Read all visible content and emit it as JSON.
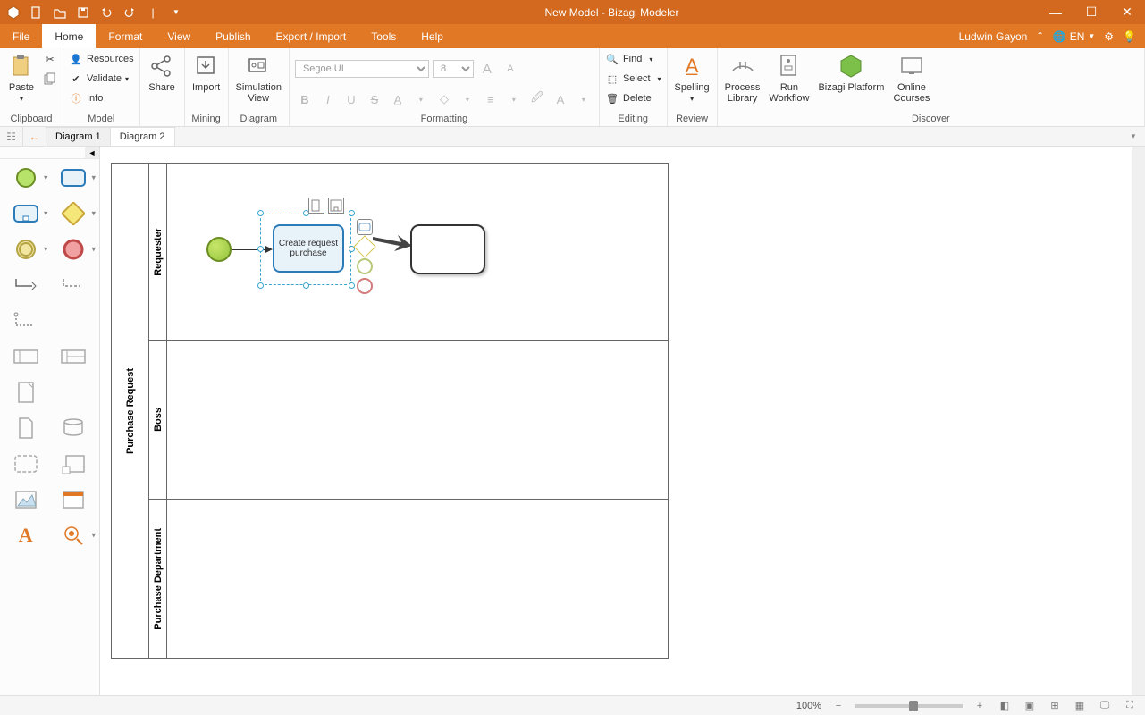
{
  "titlebar": {
    "title": "New Model - Bizagi Modeler"
  },
  "menu": {
    "tabs": [
      "File",
      "Home",
      "Format",
      "View",
      "Publish",
      "Export / Import",
      "Tools",
      "Help"
    ],
    "active": "Home",
    "user": "Ludwin Gayon",
    "lang": "EN"
  },
  "ribbon": {
    "clipboard": {
      "paste": "Paste",
      "label": "Clipboard"
    },
    "model": {
      "resources": "Resources",
      "validate": "Validate",
      "info": "Info",
      "label": "Model"
    },
    "share": {
      "label": "Share"
    },
    "mining": {
      "import": "Import",
      "label": "Mining"
    },
    "diagram": {
      "sim": "Simulation\nView",
      "label": "Diagram"
    },
    "formatting": {
      "font": "Segoe UI",
      "size": "8",
      "label": "Formatting"
    },
    "editing": {
      "find": "Find",
      "select": "Select",
      "delete": "Delete",
      "label": "Editing"
    },
    "review": {
      "spelling": "Spelling",
      "label": "Review"
    },
    "discover": {
      "plib": "Process\nLibrary",
      "run": "Run\nWorkflow",
      "platform": "Bizagi Platform",
      "courses": "Online\nCourses",
      "label": "Discover"
    }
  },
  "tabs": {
    "d1": "Diagram 1",
    "d2": "Diagram 2"
  },
  "pool": {
    "title": "Purchase Request"
  },
  "lanes": [
    "Requester",
    "Boss",
    "Purchase Department"
  ],
  "task1": "Create request purchase",
  "status": {
    "zoom": "100%"
  }
}
